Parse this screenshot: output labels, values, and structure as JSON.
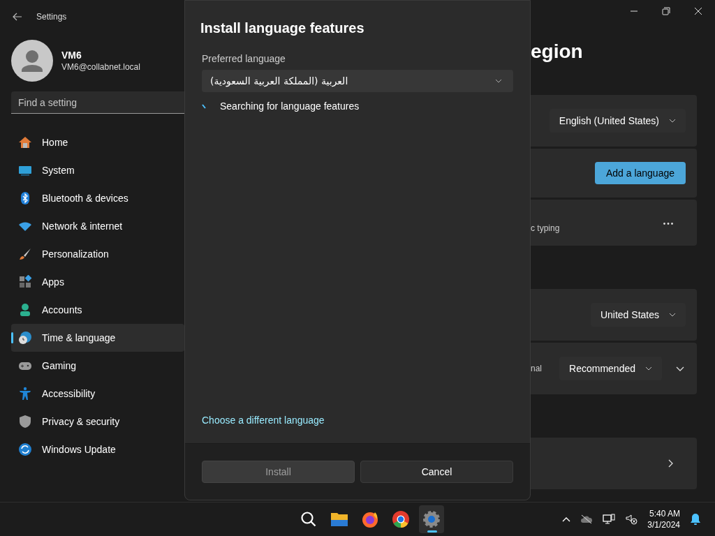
{
  "window": {
    "title": "Settings"
  },
  "user": {
    "name": "VM6",
    "email": "VM6@collabnet.local"
  },
  "search": {
    "placeholder": "Find a setting"
  },
  "nav": [
    {
      "kind": "home",
      "label": "Home",
      "selected": false
    },
    {
      "kind": "system",
      "label": "System",
      "selected": false
    },
    {
      "kind": "bluetooth",
      "label": "Bluetooth & devices",
      "selected": false
    },
    {
      "kind": "network",
      "label": "Network & internet",
      "selected": false
    },
    {
      "kind": "personalization",
      "label": "Personalization",
      "selected": false
    },
    {
      "kind": "apps",
      "label": "Apps",
      "selected": false
    },
    {
      "kind": "accounts",
      "label": "Accounts",
      "selected": false
    },
    {
      "kind": "time",
      "label": "Time & language",
      "selected": true
    },
    {
      "kind": "gaming",
      "label": "Gaming",
      "selected": false
    },
    {
      "kind": "accessibility",
      "label": "Accessibility",
      "selected": false
    },
    {
      "kind": "privacy",
      "label": "Privacy & security",
      "selected": false
    },
    {
      "kind": "update",
      "label": "Windows Update",
      "selected": false
    }
  ],
  "page": {
    "title": "egion",
    "sections": [
      [
        {
          "kind": "dropdown",
          "value": "English (United States)"
        },
        {
          "kind": "button",
          "label": "Add a language"
        },
        {
          "kind": "more",
          "text": "c typing"
        }
      ],
      [
        {
          "kind": "dropdown",
          "value": "United States"
        },
        {
          "kind": "dropdown",
          "text": "nal",
          "value": "Recommended",
          "expandable": true
        }
      ],
      [
        {
          "kind": "link"
        }
      ]
    ]
  },
  "dialog": {
    "title": "Install language features",
    "field_label": "Preferred language",
    "language": "العربية (المملكة العربية السعودية)",
    "status": "Searching for language features",
    "link": "Choose a different language",
    "buttons": [
      {
        "label": "Install",
        "disabled": true
      },
      {
        "label": "Cancel",
        "disabled": false
      }
    ]
  },
  "taskbar": {
    "apps": [
      {
        "kind": "search",
        "selected": false
      },
      {
        "kind": "explorer",
        "selected": false
      },
      {
        "kind": "firefox",
        "selected": false
      },
      {
        "kind": "chrome",
        "selected": false
      },
      {
        "kind": "settings",
        "selected": true
      }
    ],
    "time": "5:40 AM",
    "date": "3/1/2024"
  }
}
